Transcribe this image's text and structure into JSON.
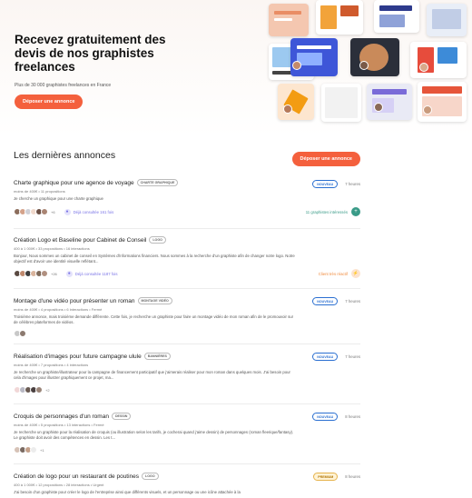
{
  "hero": {
    "title": "Recevez gratuitement des devis de nos graphistes freelances",
    "subtitle": "Plus de 30 000 graphistes freelances en France",
    "cta": "Déposer une annonce"
  },
  "section": {
    "title": "Les dernières annonces",
    "cta": "Déposer une annonce"
  },
  "listings": [
    {
      "title": "Charte graphique pour une agence de voyage",
      "tag": "CHARTE GRAPHIQUE",
      "meta": "moins de 400€ • 11 propositions",
      "desc": "Je cherche un graphique pour une charte graphique",
      "badge": "NOUVEAU",
      "time": "7 heures",
      "more": "+6",
      "consult": "Déjà consultée 161 fois",
      "info": "11 graphistes intéressés",
      "info_icon": "+",
      "info_color": "#3a9b88"
    },
    {
      "title": "Création Logo et Baseline pour Cabinet de Conseil",
      "tag": "LOGO",
      "meta": "400 à 1 000€ • 33 propositions • 16 interactions",
      "desc": "Bonjour, Nous sommes un cabinet de conseil en Systèmes d'informations financiers. Nous sommes à la recherche d'un graphiste afin de changer notre logo. Notre objectif est d'avoir une identité visuelle reflétant...",
      "badge": "",
      "time": "",
      "more": "+26",
      "consult": "Déjà consultée 1187 fois",
      "info": "Client très réactif",
      "info_icon": "⚡",
      "info_color": "#f08a3c"
    },
    {
      "title": "Montage d'une vidéo pour présenter un roman",
      "tag": "MONTAGE VIDÉO",
      "meta": "moins de 400€ • 4 propositions • 6 interactions • Fermé",
      "desc": "Troisième annonce, mais troisième demande différente. Cette fois, je recherche un graphiste pour faire un montage vidéo de mon roman afin de le promouvoir sur de célèbres plateformes de vidéos.",
      "badge": "NOUVEAU",
      "time": "7 heures",
      "more": "",
      "consult": "",
      "info": "",
      "info_icon": "",
      "info_color": ""
    },
    {
      "title": "Réalisation d'images pour future campagne ulule",
      "tag": "BANNIÈRES",
      "meta": "moins de 400€ • 7 propositions • 4 interactions",
      "desc": "Je recherche un graphiste/illustrateur pour la campagne de financement participatif que j'aimerais réaliser pour mon roman dans quelques mois. J'ai besoin pour cela d'images pour illustrer graphiquement ce projet, ma...",
      "badge": "NOUVEAU",
      "time": "7 heures",
      "more": "+2",
      "consult": "",
      "info": "",
      "info_icon": "",
      "info_color": ""
    },
    {
      "title": "Croquis de personnages d'un roman",
      "tag": "DESSIN",
      "meta": "moins de 400€ • 5 propositions • 13 interactions • Fermé",
      "desc": "Je recherche un graphiste pour la réalisation de croquis (ou illustration selon les tarifs, je cocherai quand j'aime dessin) de personnages (roman fleerique/fantasy). Le graphiste doit avoir des compétences en dessin. Les t...",
      "badge": "NOUVEAU",
      "time": "8 heures",
      "more": "+1",
      "consult": "",
      "info": "",
      "info_icon": "",
      "info_color": ""
    },
    {
      "title": "Création de logo pour un restaurant de poutines",
      "tag": "LOGO",
      "meta": "400 à 1 000€ • 12 propositions • 28 interactions • Urgent",
      "desc": "J'ai besoin d'un graphiste pour créer le logo de l'entreprise ainsi que différents visuels, et un personnage ou une icône attachée à la",
      "badge": "PREMIUM",
      "time": "8 heures",
      "more": "",
      "consult": "",
      "info": "",
      "info_icon": "",
      "info_color": ""
    }
  ]
}
